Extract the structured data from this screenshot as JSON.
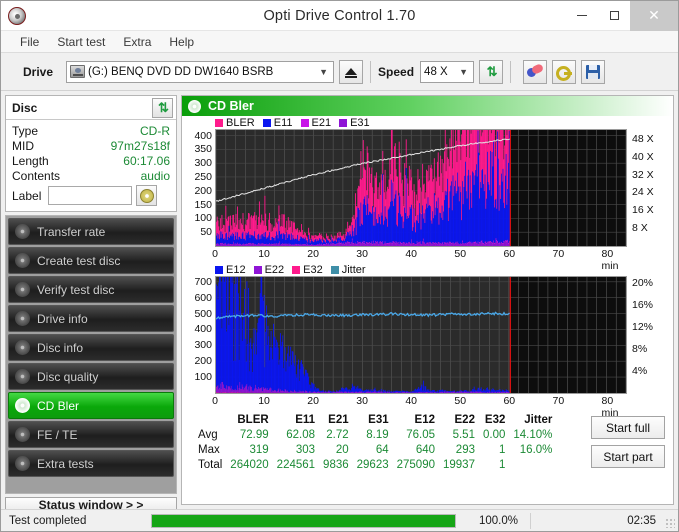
{
  "window": {
    "title": "Opti Drive Control 1.70",
    "minimize": "–",
    "maximize": "□",
    "close": "✕"
  },
  "menu": [
    "File",
    "Start test",
    "Extra",
    "Help"
  ],
  "toolbar": {
    "drive_label": "Drive",
    "drive_value": "(G:)   BENQ DVD DD DW1640 BSRB",
    "speed_label": "Speed",
    "speed_value": "48 X",
    "eject_title": "Eject",
    "refresh_title": "Refresh",
    "erase_title": "Erase",
    "key_title": "Key",
    "save_title": "Save"
  },
  "disc": {
    "title": "Disc",
    "rows": [
      {
        "key": "Type",
        "value": "CD-R"
      },
      {
        "key": "MID",
        "value": "97m27s18f"
      },
      {
        "key": "Length",
        "value": "60:17.06"
      },
      {
        "key": "Contents",
        "value": "audio"
      }
    ],
    "label_key": "Label",
    "label_value": ""
  },
  "sidebar": {
    "items": [
      {
        "label": "Transfer rate",
        "active": false
      },
      {
        "label": "Create test disc",
        "active": false
      },
      {
        "label": "Verify test disc",
        "active": false
      },
      {
        "label": "Drive info",
        "active": false
      },
      {
        "label": "Disc info",
        "active": false
      },
      {
        "label": "Disc quality",
        "active": false
      },
      {
        "label": "CD Bler",
        "active": true
      },
      {
        "label": "FE / TE",
        "active": false
      },
      {
        "label": "Extra tests",
        "active": false
      }
    ],
    "status_window": "Status window > >"
  },
  "panel": {
    "title": "CD Bler"
  },
  "buttons": {
    "start_full": "Start full",
    "start_part": "Start part"
  },
  "statusbar": {
    "text": "Test completed",
    "percent": "100.0%",
    "progress": 100,
    "time": "02:35"
  },
  "stats": {
    "columns": [
      "BLER",
      "E11",
      "E21",
      "E31",
      "E12",
      "E22",
      "E32",
      "Jitter"
    ],
    "rows": [
      {
        "name": "Avg",
        "values": [
          "72.99",
          "62.08",
          "2.72",
          "8.19",
          "76.05",
          "5.51",
          "0.00",
          "14.10%"
        ]
      },
      {
        "name": "Max",
        "values": [
          "319",
          "303",
          "20",
          "64",
          "640",
          "293",
          "1",
          "16.0%"
        ]
      },
      {
        "name": "Total",
        "values": [
          "264020",
          "224561",
          "9836",
          "29623",
          "275090",
          "19937",
          "1",
          ""
        ]
      }
    ]
  },
  "chart_data": [
    {
      "type": "area",
      "id": "bler-chart",
      "title": "CD Bler errors",
      "xlabel": "min",
      "ylabel": "",
      "xlim": [
        0,
        84
      ],
      "ylim": [
        0,
        420
      ],
      "xticks": [
        0,
        10,
        20,
        30,
        40,
        50,
        60,
        70,
        80
      ],
      "xticklabels": [
        "0",
        "10",
        "20",
        "30",
        "40",
        "50",
        "60",
        "70",
        "80 min"
      ],
      "yticks": [
        50,
        100,
        150,
        200,
        250,
        300,
        350,
        400
      ],
      "y2label": "X",
      "y2lim": [
        0,
        52
      ],
      "y2ticks": [
        8,
        16,
        24,
        32,
        40,
        48
      ],
      "y2ticklabels": [
        "8 X",
        "16 X",
        "24 X",
        "32 X",
        "40 X",
        "48 X"
      ],
      "grid": true,
      "legend": [
        "BLER",
        "E11",
        "E21",
        "E31"
      ],
      "colors": [
        "#ff1a8c",
        "#0b16f0",
        "#c814e8",
        "#8f14d6"
      ],
      "data_end_min": 60.3,
      "marker_line_min": 60.3,
      "series": [
        {
          "name": "BLER",
          "color": "#ff1a8c",
          "x": [
            0,
            2,
            4,
            6,
            8,
            10,
            12,
            14,
            16,
            18,
            20,
            22,
            24,
            26,
            28,
            30,
            32,
            34,
            36,
            38,
            40,
            42,
            44,
            46,
            48,
            50,
            52,
            54,
            56,
            58,
            60
          ],
          "values": [
            48,
            45,
            52,
            47,
            55,
            50,
            44,
            48,
            40,
            18,
            15,
            14,
            13,
            16,
            40,
            150,
            120,
            95,
            180,
            120,
            90,
            115,
            130,
            150,
            175,
            200,
            215,
            240,
            260,
            285,
            300
          ]
        },
        {
          "name": "E11",
          "color": "#0b16f0",
          "x": [
            0,
            2,
            4,
            6,
            8,
            10,
            12,
            14,
            16,
            18,
            20,
            22,
            24,
            26,
            28,
            30,
            32,
            34,
            36,
            38,
            40,
            42,
            44,
            46,
            48,
            50,
            52,
            54,
            56,
            58,
            60
          ],
          "values": [
            30,
            28,
            32,
            29,
            33,
            30,
            27,
            29,
            25,
            15,
            13,
            12,
            11,
            14,
            35,
            120,
            100,
            80,
            150,
            105,
            80,
            100,
            115,
            130,
            155,
            180,
            195,
            215,
            235,
            255,
            275
          ]
        },
        {
          "name": "E21",
          "color": "#c814e8",
          "x": [
            0,
            10,
            20,
            30,
            40,
            50,
            60
          ],
          "values": [
            2,
            2,
            1,
            4,
            3,
            3,
            4
          ]
        },
        {
          "name": "E31",
          "color": "#8f14d6",
          "x": [
            0,
            10,
            20,
            30,
            40,
            50,
            60
          ],
          "values": [
            6,
            6,
            4,
            10,
            8,
            9,
            12
          ]
        },
        {
          "name": "Speed",
          "color": "#e8e8e8",
          "x": [
            0,
            10,
            20,
            30,
            40,
            50,
            60
          ],
          "values": [
            20,
            26,
            32,
            37,
            41,
            45,
            48
          ]
        }
      ]
    },
    {
      "type": "area",
      "id": "e12-chart",
      "title": "CD Bler E12 / Jitter",
      "xlabel": "min",
      "ylabel": "",
      "xlim": [
        0,
        84
      ],
      "ylim": [
        0,
        730
      ],
      "xticks": [
        0,
        10,
        20,
        30,
        40,
        50,
        60,
        70,
        80
      ],
      "xticklabels": [
        "0",
        "10",
        "20",
        "30",
        "40",
        "50",
        "60",
        "70",
        "80 min"
      ],
      "yticks": [
        100,
        200,
        300,
        400,
        500,
        600,
        700
      ],
      "y2label": "%",
      "y2lim": [
        0,
        21
      ],
      "y2ticks": [
        4,
        8,
        12,
        16,
        20
      ],
      "y2ticklabels": [
        "4%",
        "8%",
        "12%",
        "16%",
        "20%"
      ],
      "grid": true,
      "legend": [
        "E12",
        "E22",
        "E32",
        "Jitter"
      ],
      "colors": [
        "#0b16f0",
        "#8f14d6",
        "#ff1a8c",
        "#3f8fa8"
      ],
      "data_end_min": 60.3,
      "marker_line_min": 60.3,
      "series": [
        {
          "name": "E12",
          "color": "#0b16f0",
          "x": [
            0,
            1,
            2,
            3,
            4,
            5,
            6,
            7,
            8,
            9,
            10,
            11,
            12,
            13,
            14,
            15,
            16,
            17,
            18,
            19,
            20,
            21,
            22,
            23,
            24,
            25,
            26,
            27,
            28,
            29,
            30,
            32,
            34,
            36,
            38,
            40,
            42,
            44,
            46,
            48,
            50,
            52,
            54,
            56,
            58,
            60
          ],
          "values": [
            560,
            620,
            700,
            500,
            470,
            430,
            360,
            330,
            300,
            520,
            300,
            280,
            230,
            200,
            180,
            160,
            140,
            120,
            100,
            90,
            30,
            10,
            8,
            6,
            5,
            5,
            20,
            20,
            30,
            25,
            15,
            10,
            8,
            6,
            5,
            5,
            30,
            10,
            8,
            6,
            5,
            8,
            20,
            15,
            10,
            8
          ]
        },
        {
          "name": "E22",
          "color": "#8f14d6",
          "x": [
            0,
            10,
            20,
            30,
            40,
            50,
            60
          ],
          "values": [
            40,
            20,
            6,
            6,
            4,
            6,
            5
          ]
        },
        {
          "name": "E32",
          "color": "#ff1a8c",
          "x": [
            0,
            10,
            20,
            30,
            40,
            50,
            60
          ],
          "values": [
            2,
            1,
            0,
            0,
            0,
            0,
            0
          ]
        },
        {
          "name": "Jitter",
          "color": "#4aa8e8",
          "unit": "%",
          "x": [
            0,
            4,
            8,
            12,
            16,
            20,
            24,
            28,
            32,
            36,
            40,
            44,
            48,
            52,
            56,
            60
          ],
          "values": [
            13.6,
            13.9,
            14.0,
            13.9,
            14.1,
            14.2,
            14.0,
            14.1,
            14.2,
            14.3,
            14.2,
            14.1,
            14.3,
            14.2,
            14.4,
            14.3
          ]
        }
      ]
    }
  ]
}
